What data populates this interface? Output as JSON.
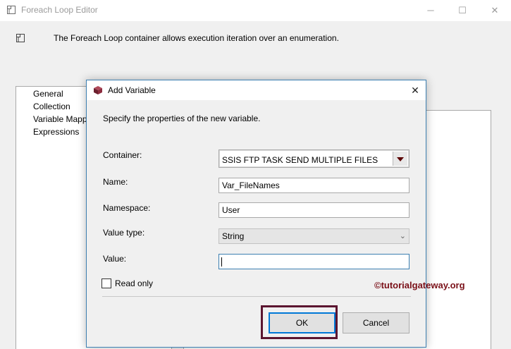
{
  "background_window": {
    "title": "Foreach Loop Editor",
    "description": "The Foreach Loop container allows execution iteration over an enumeration.",
    "nav_items": [
      "General",
      "Collection",
      "Variable Mapp",
      "Expressions"
    ],
    "window_controls": {
      "minimize": "─",
      "maximize": "☐",
      "close": "✕"
    }
  },
  "dialog": {
    "title": "Add Variable",
    "close_glyph": "✕",
    "instructions": "Specify the properties of the new variable.",
    "fields": {
      "container": {
        "label": "Container:",
        "value": "SSIS FTP TASK SEND MULTIPLE FILES"
      },
      "name": {
        "label": "Name:",
        "value": "Var_FileNames"
      },
      "namespace": {
        "label": "Namespace:",
        "value": "User"
      },
      "value_type": {
        "label": "Value type:",
        "value": "String"
      },
      "value": {
        "label": "Value:",
        "value": ""
      }
    },
    "read_only": {
      "label": "Read only",
      "checked": false
    },
    "buttons": {
      "ok": "OK",
      "cancel": "Cancel"
    }
  },
  "watermark": "©tutorialgateway.org",
  "colors": {
    "accent": "#0078d7",
    "highlight_box": "#5b1530",
    "watermark": "#7a1018"
  },
  "icons": [
    "editor-window-icon",
    "info-container-icon",
    "add-variable-icon",
    "chevron-down-icon",
    "dropdown-arrow-icon"
  ]
}
